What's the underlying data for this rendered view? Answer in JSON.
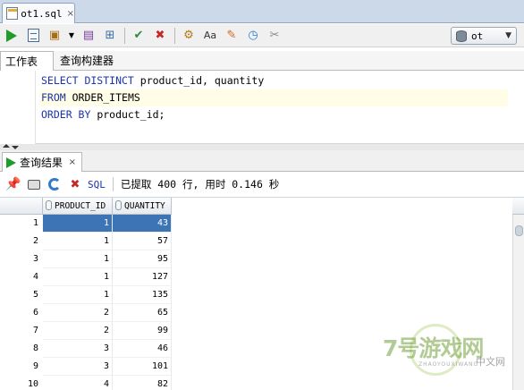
{
  "file_tab": {
    "label": "ot1.sql",
    "close": "×",
    "icon": "sql-file-icon"
  },
  "toolbar": {
    "connection": "ot",
    "icons": [
      "run-statement-icon",
      "run-script-icon",
      "autotrace-icon",
      "explain-plan-icon",
      "sql-tuning-icon",
      "commit-icon",
      "rollback-icon",
      "format-sql-icon",
      "to-upper-icon",
      "eraser-icon",
      "history-icon",
      "unshared-worksheet-icon"
    ]
  },
  "subtabs": {
    "worksheet": "工作表",
    "query_builder": "查询构建器"
  },
  "editor": {
    "lines": [
      {
        "kw": "SELECT DISTINCT",
        "rest": " product_id, quantity"
      },
      {
        "kw": "FROM",
        "rest": " ORDER_ITEMS"
      },
      {
        "kw": "ORDER BY",
        "rest": " product_id;"
      }
    ]
  },
  "results": {
    "tab_label": "查询结果",
    "tab_close": "×",
    "sql_link": "SQL",
    "status": "已提取 400 行, 用时 0.146 秒"
  },
  "grid": {
    "columns": [
      "PRODUCT_ID",
      "QUANTITY"
    ],
    "rows": [
      {
        "n": "1",
        "product_id": "1",
        "quantity": "43"
      },
      {
        "n": "2",
        "product_id": "1",
        "quantity": "57"
      },
      {
        "n": "3",
        "product_id": "1",
        "quantity": "95"
      },
      {
        "n": "4",
        "product_id": "1",
        "quantity": "127"
      },
      {
        "n": "5",
        "product_id": "1",
        "quantity": "135"
      },
      {
        "n": "6",
        "product_id": "2",
        "quantity": "65"
      },
      {
        "n": "7",
        "product_id": "2",
        "quantity": "99"
      },
      {
        "n": "8",
        "product_id": "3",
        "quantity": "46"
      },
      {
        "n": "9",
        "product_id": "3",
        "quantity": "101"
      },
      {
        "n": "10",
        "product_id": "4",
        "quantity": "82"
      }
    ]
  },
  "watermark": {
    "logo": "7号游戏网",
    "sub": "ZHAOYOUXIWANG",
    "cn": "中文网"
  },
  "colors": {
    "selection": "#3c74b6",
    "keyword": "#1c34a6",
    "run": "#1f9c2a"
  }
}
